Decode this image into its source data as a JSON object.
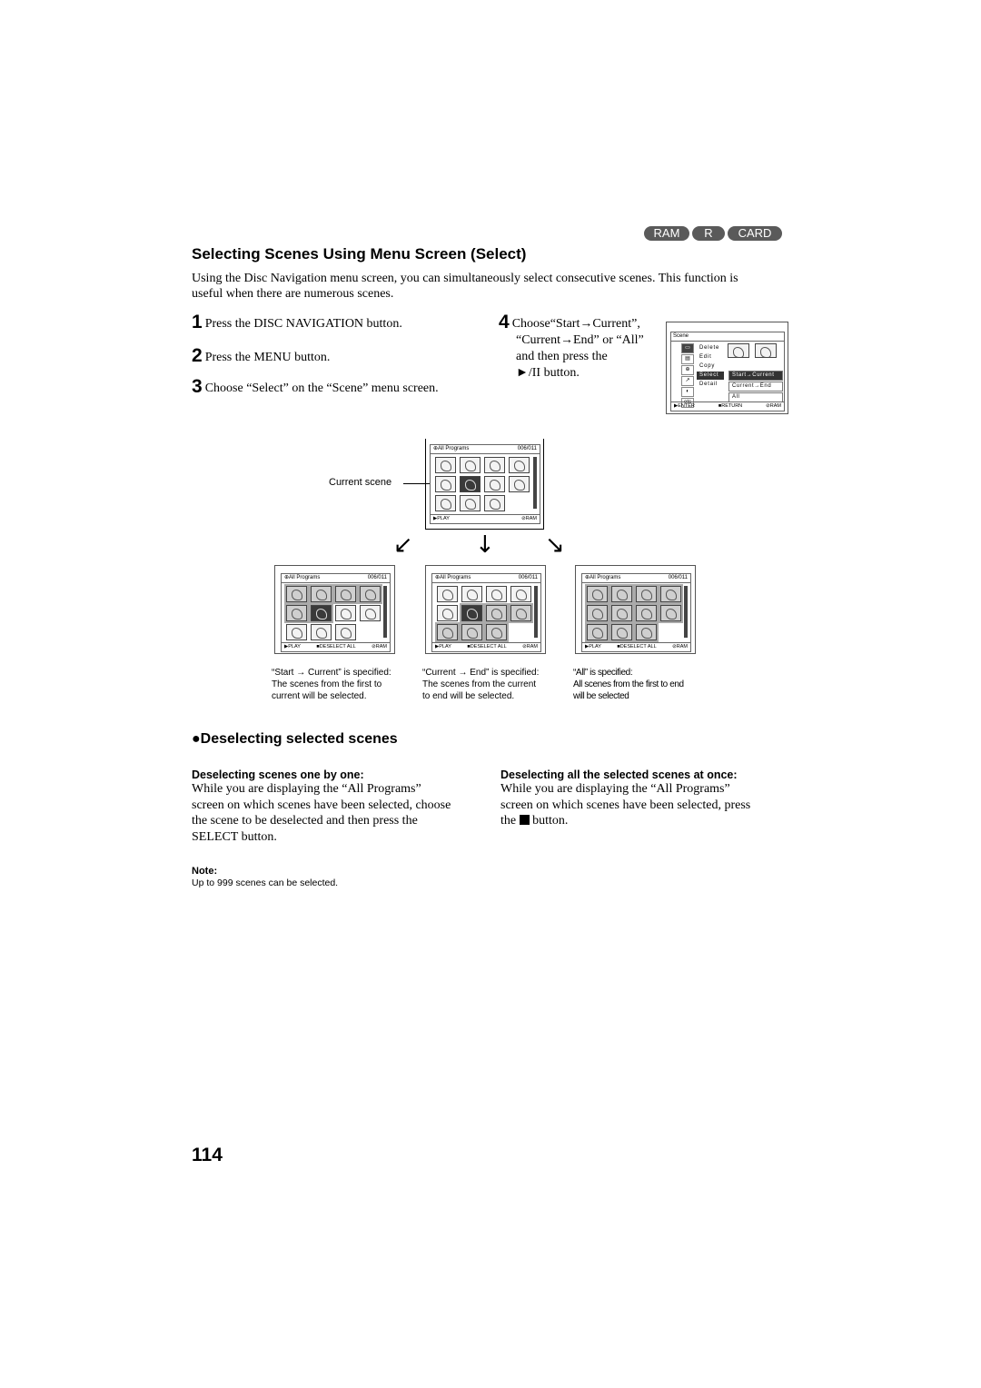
{
  "badges": [
    "RAM",
    "R",
    "CARD"
  ],
  "section": {
    "title": "Selecting Scenes Using Menu Screen (Select)",
    "intro": "Using the Disc Navigation menu screen, you can simultaneously select consecutive scenes. This function is useful when there are numerous scenes."
  },
  "steps": [
    {
      "num": "1",
      "text": "Press the DISC NAVIGATION button."
    },
    {
      "num": "2",
      "text": "Press the MENU button."
    },
    {
      "num": "3",
      "text": "Choose “Select” on the “Scene” menu screen."
    },
    {
      "num": "4",
      "lines": [
        "Choose“Start→Current”,",
        "“Current→End” or “All”",
        "and then press the",
        "►/II button."
      ]
    }
  ],
  "scene_menu": {
    "title": "Scene",
    "icons": [
      "disc-icon",
      "edit-icon",
      "copy-icon",
      "select-icon",
      "detail-icon",
      "etc"
    ],
    "items": [
      "Delete",
      "Edit",
      "Copy",
      "Select",
      "Detail"
    ],
    "highlighted": "Select",
    "submenu": [
      "Start→Current",
      "Current→End",
      "All"
    ],
    "submenu_highlighted": "Start→Current",
    "footer_left": "ENTER",
    "footer_mid": "RETURN",
    "footer_right": "RAM"
  },
  "top_screen": {
    "header_left": "All Programs",
    "header_right": "006/011",
    "footer_left": "PLAY",
    "footer_right": "RAM",
    "callout": "Current scene",
    "current_index": 5
  },
  "result_screens": [
    {
      "header_left": "All Programs",
      "header_right": "006/011",
      "footer_left": "PLAY",
      "footer_mid": "DESELECT ALL",
      "footer_right": "RAM",
      "caption_lines": [
        "“Start → Current” is specified:",
        "The scenes from the first to",
        "current will be selected."
      ],
      "selected_range": [
        0,
        5
      ]
    },
    {
      "header_left": "All Programs",
      "header_right": "006/011",
      "footer_left": "PLAY",
      "footer_mid": "DESELECT ALL",
      "footer_right": "RAM",
      "caption_lines": [
        "“Current → End” is specified:",
        "The scenes from the current",
        "to end will be selected."
      ],
      "selected_range": [
        5,
        10
      ]
    },
    {
      "header_left": "All Programs",
      "header_right": "006/011",
      "footer_left": "PLAY",
      "footer_mid": "DESELECT ALL",
      "footer_right": "RAM",
      "caption_lines": [
        "“All” is specified:",
        "All scenes from the first to end",
        "will be selected"
      ],
      "selected_range": [
        0,
        10
      ]
    }
  ],
  "deselect": {
    "title": "Deselecting selected scenes",
    "one_by_one": {
      "heading": "Deselecting scenes one by one:",
      "lines": [
        "While you are displaying the “All Programs”",
        "screen on which scenes have been selected, choose",
        "the scene to be deselected and then press the",
        "SELECT button."
      ]
    },
    "all_at_once": {
      "heading": "Deselecting all the selected scenes at once:",
      "lines": [
        "While you are displaying the “All Programs”",
        "screen on which scenes have been selected, press"
      ],
      "last_prefix": "the",
      "last_suffix": "button."
    }
  },
  "note": {
    "title": "Note:",
    "text": "Up to 999 scenes can be selected."
  },
  "page_number": "114"
}
